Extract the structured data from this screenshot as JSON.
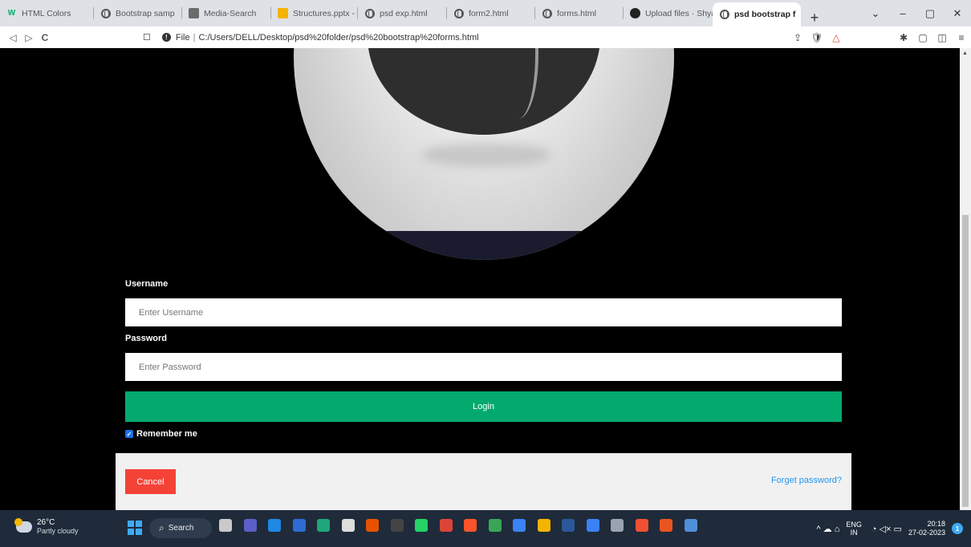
{
  "browser": {
    "tabs": [
      {
        "label": "HTML Colors",
        "favicon": "w3schools-icon",
        "color": "#04aa6d"
      },
      {
        "label": "Bootstrap samp",
        "favicon": "globe-icon"
      },
      {
        "label": "Media-Search",
        "favicon": "media-icon"
      },
      {
        "label": "Structures.pptx - Gc",
        "favicon": "slides-icon",
        "color": "#f4b400"
      },
      {
        "label": "psd exp.html",
        "favicon": "globe-icon"
      },
      {
        "label": "form2.html",
        "favicon": "globe-icon"
      },
      {
        "label": "forms.html",
        "favicon": "globe-icon"
      },
      {
        "label": "Upload files · Shyan",
        "favicon": "github-icon"
      },
      {
        "label": "psd bootstrap f",
        "favicon": "globe-icon",
        "active": true
      }
    ],
    "new_tab": "+",
    "window_controls": {
      "menu": "⌄",
      "minimize": "–",
      "maximize": "▢",
      "close": "✕"
    },
    "nav": {
      "back": "◁",
      "forward": "▷",
      "reload": "C"
    },
    "bookmark_icon": "☐",
    "address": {
      "scheme": "File",
      "separator": "|",
      "url": "C:/Users/DELL/Desktop/psd%20folder/psd%20bootstrap%20forms.html"
    },
    "toolbar_right": [
      "⇪",
      "🛡",
      "△",
      "✱",
      "▢",
      "◫",
      "≡"
    ]
  },
  "form": {
    "username_label": "Username",
    "username_placeholder": "Enter Username",
    "password_label": "Password",
    "password_placeholder": "Enter Password",
    "login_label": "Login",
    "remember_label": "Remember me",
    "remember_checked": true,
    "cancel_label": "Cancel",
    "forgot_label": "Forget password?",
    "login_color": "#04aa6d",
    "cancel_color": "#f44336",
    "link_color": "#2196f3"
  },
  "taskbar": {
    "temperature": "26°C",
    "condition": "Partly cloudy",
    "search_label": "Search",
    "search_icon": "⌕",
    "apps": [
      "file-explorer-icon",
      "teams-icon",
      "mail-icon",
      "store-icon",
      "edge-icon",
      "paint-icon",
      "office-icon",
      "terminal-icon",
      "whatsapp-icon",
      "chrome-icon",
      "brave-icon",
      "notepad-icon",
      "notes-icon",
      "folder-icon",
      "word-icon",
      "vscode-icon",
      "settings-icon",
      "git-icon",
      "ubuntu-icon",
      "photos-icon"
    ],
    "app_colors": [
      "#c9c9c9",
      "#5b5fc7",
      "#1e88e5",
      "#2f6bd5",
      "#1fa67a",
      "#dddddd",
      "#e65100",
      "#444444",
      "#25d366",
      "#db4437",
      "#fb542b",
      "#3aa655",
      "#3b82f6",
      "#f4b400",
      "#2b579a",
      "#3b82f6",
      "#9aa4b0",
      "#f05033",
      "#e95420",
      "#4f8ed8"
    ],
    "tray_symbols": "^ ☁ ⌂",
    "lang_top": "ENG",
    "lang_bottom": "IN",
    "status_symbols": "◔ ◁× ▭",
    "time": "20:18",
    "date": "27-02-2023",
    "notifications": "1"
  }
}
